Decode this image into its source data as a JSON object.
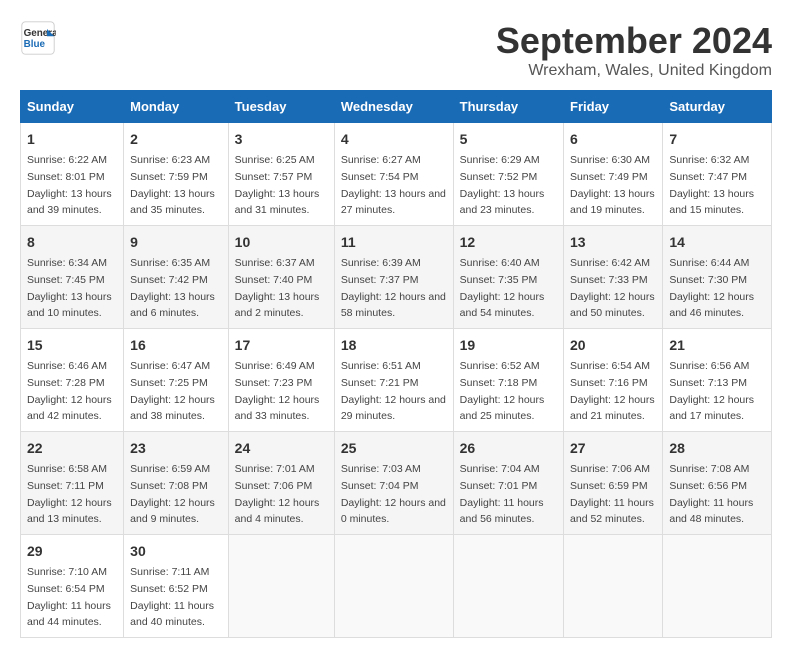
{
  "header": {
    "logo_line1": "General",
    "logo_line2": "Blue",
    "title": "September 2024",
    "subtitle": "Wrexham, Wales, United Kingdom"
  },
  "days_of_week": [
    "Sunday",
    "Monday",
    "Tuesday",
    "Wednesday",
    "Thursday",
    "Friday",
    "Saturday"
  ],
  "weeks": [
    [
      {
        "day": 1,
        "sunrise": "6:22 AM",
        "sunset": "8:01 PM",
        "daylight": "13 hours and 39 minutes."
      },
      {
        "day": 2,
        "sunrise": "6:23 AM",
        "sunset": "7:59 PM",
        "daylight": "13 hours and 35 minutes."
      },
      {
        "day": 3,
        "sunrise": "6:25 AM",
        "sunset": "7:57 PM",
        "daylight": "13 hours and 31 minutes."
      },
      {
        "day": 4,
        "sunrise": "6:27 AM",
        "sunset": "7:54 PM",
        "daylight": "13 hours and 27 minutes."
      },
      {
        "day": 5,
        "sunrise": "6:29 AM",
        "sunset": "7:52 PM",
        "daylight": "13 hours and 23 minutes."
      },
      {
        "day": 6,
        "sunrise": "6:30 AM",
        "sunset": "7:49 PM",
        "daylight": "13 hours and 19 minutes."
      },
      {
        "day": 7,
        "sunrise": "6:32 AM",
        "sunset": "7:47 PM",
        "daylight": "13 hours and 15 minutes."
      }
    ],
    [
      {
        "day": 8,
        "sunrise": "6:34 AM",
        "sunset": "7:45 PM",
        "daylight": "13 hours and 10 minutes."
      },
      {
        "day": 9,
        "sunrise": "6:35 AM",
        "sunset": "7:42 PM",
        "daylight": "13 hours and 6 minutes."
      },
      {
        "day": 10,
        "sunrise": "6:37 AM",
        "sunset": "7:40 PM",
        "daylight": "13 hours and 2 minutes."
      },
      {
        "day": 11,
        "sunrise": "6:39 AM",
        "sunset": "7:37 PM",
        "daylight": "12 hours and 58 minutes."
      },
      {
        "day": 12,
        "sunrise": "6:40 AM",
        "sunset": "7:35 PM",
        "daylight": "12 hours and 54 minutes."
      },
      {
        "day": 13,
        "sunrise": "6:42 AM",
        "sunset": "7:33 PM",
        "daylight": "12 hours and 50 minutes."
      },
      {
        "day": 14,
        "sunrise": "6:44 AM",
        "sunset": "7:30 PM",
        "daylight": "12 hours and 46 minutes."
      }
    ],
    [
      {
        "day": 15,
        "sunrise": "6:46 AM",
        "sunset": "7:28 PM",
        "daylight": "12 hours and 42 minutes."
      },
      {
        "day": 16,
        "sunrise": "6:47 AM",
        "sunset": "7:25 PM",
        "daylight": "12 hours and 38 minutes."
      },
      {
        "day": 17,
        "sunrise": "6:49 AM",
        "sunset": "7:23 PM",
        "daylight": "12 hours and 33 minutes."
      },
      {
        "day": 18,
        "sunrise": "6:51 AM",
        "sunset": "7:21 PM",
        "daylight": "12 hours and 29 minutes."
      },
      {
        "day": 19,
        "sunrise": "6:52 AM",
        "sunset": "7:18 PM",
        "daylight": "12 hours and 25 minutes."
      },
      {
        "day": 20,
        "sunrise": "6:54 AM",
        "sunset": "7:16 PM",
        "daylight": "12 hours and 21 minutes."
      },
      {
        "day": 21,
        "sunrise": "6:56 AM",
        "sunset": "7:13 PM",
        "daylight": "12 hours and 17 minutes."
      }
    ],
    [
      {
        "day": 22,
        "sunrise": "6:58 AM",
        "sunset": "7:11 PM",
        "daylight": "12 hours and 13 minutes."
      },
      {
        "day": 23,
        "sunrise": "6:59 AM",
        "sunset": "7:08 PM",
        "daylight": "12 hours and 9 minutes."
      },
      {
        "day": 24,
        "sunrise": "7:01 AM",
        "sunset": "7:06 PM",
        "daylight": "12 hours and 4 minutes."
      },
      {
        "day": 25,
        "sunrise": "7:03 AM",
        "sunset": "7:04 PM",
        "daylight": "12 hours and 0 minutes."
      },
      {
        "day": 26,
        "sunrise": "7:04 AM",
        "sunset": "7:01 PM",
        "daylight": "11 hours and 56 minutes."
      },
      {
        "day": 27,
        "sunrise": "7:06 AM",
        "sunset": "6:59 PM",
        "daylight": "11 hours and 52 minutes."
      },
      {
        "day": 28,
        "sunrise": "7:08 AM",
        "sunset": "6:56 PM",
        "daylight": "11 hours and 48 minutes."
      }
    ],
    [
      {
        "day": 29,
        "sunrise": "7:10 AM",
        "sunset": "6:54 PM",
        "daylight": "11 hours and 44 minutes."
      },
      {
        "day": 30,
        "sunrise": "7:11 AM",
        "sunset": "6:52 PM",
        "daylight": "11 hours and 40 minutes."
      },
      null,
      null,
      null,
      null,
      null
    ]
  ]
}
